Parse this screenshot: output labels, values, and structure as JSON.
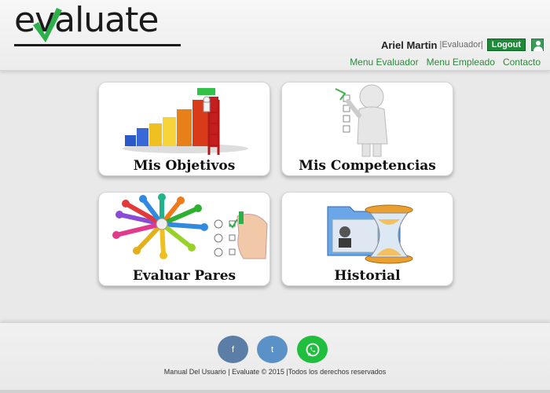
{
  "brand": {
    "logo_text": "evaluate"
  },
  "user": {
    "name": "Ariel Martin",
    "role": "|Evaluador|",
    "logout_label": "Logout"
  },
  "nav": [
    "Menu Evaluador",
    "Menu Empleado",
    "Contacto"
  ],
  "cards": [
    {
      "label": "Mis Objetivos"
    },
    {
      "label": "Mis Competencias"
    },
    {
      "label": "Evaluar Pares"
    },
    {
      "label": "Historial"
    }
  ],
  "footer": {
    "social": [
      {
        "label": "f"
      },
      {
        "label": "t"
      },
      {
        "label": ""
      }
    ],
    "copyright": "Manual Del Usuario | Evaluate © 2015 |Todos los derechos reservados"
  },
  "colors": {
    "accent_green": "#2a8a3a",
    "logout_bg": "#1e8a3a",
    "background": "#e9e9e9"
  }
}
